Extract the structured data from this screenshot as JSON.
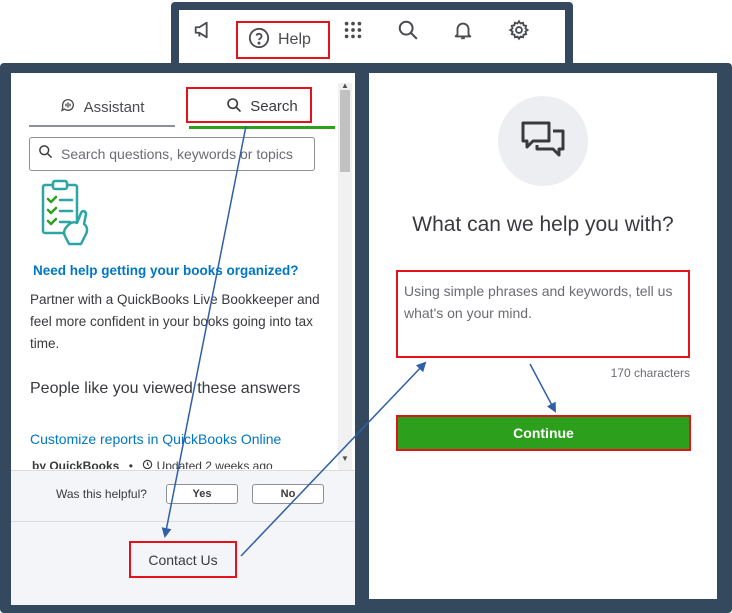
{
  "toolbar": {
    "icons": [
      "megaphone-icon",
      "help-icon",
      "apps-grid-icon",
      "search-icon",
      "bell-icon",
      "gear-icon"
    ],
    "help_label": "Help"
  },
  "left_panel": {
    "tabs": [
      {
        "label": "Assistant",
        "icon": "assistant-chat-icon"
      },
      {
        "label": "Search",
        "icon": "search-icon",
        "active": true
      }
    ],
    "search": {
      "placeholder": "Search questions, keywords or topics"
    },
    "promo": {
      "title": "Need help getting your books organized?",
      "body": "Partner with a QuickBooks Live Bookkeeper and feel more confident in your books going into tax time."
    },
    "people_heading": "People like you viewed these answers",
    "article": {
      "title": "Customize reports in QuickBooks Online",
      "author": "by QuickBooks",
      "separator": "•",
      "updated": "Updated 2 weeks ago"
    },
    "feedback": {
      "question": "Was this helpful?",
      "yes": "Yes",
      "no": "No"
    },
    "contact_label": "Contact Us"
  },
  "right_panel": {
    "icon": "chat-bubbles-icon",
    "heading": "What can we help you with?",
    "message_placeholder": "Using simple phrases and keywords, tell us what's on your mind.",
    "char_count": "170 characters",
    "continue_label": "Continue"
  },
  "colors": {
    "frame": "#34495e",
    "highlight": "#e5121b",
    "brand_green": "#2ca01c",
    "link_blue": "#0077c5",
    "arrow": "#2f5fa7"
  }
}
